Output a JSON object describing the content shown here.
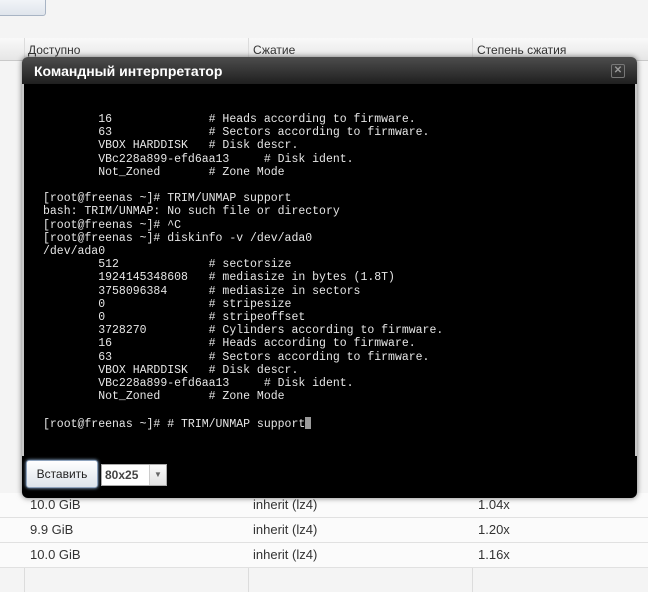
{
  "background": {
    "columns": [
      "Доступно",
      "Сжатие",
      "Степень сжатия"
    ],
    "rows": [
      {
        "available": "10.0 GiB",
        "compression": "inherit (lz4)",
        "ratio": "1.04x"
      },
      {
        "available": "9.9 GiB",
        "compression": "inherit (lz4)",
        "ratio": "1.20x"
      },
      {
        "available": "10.0 GiB",
        "compression": "inherit (lz4)",
        "ratio": "1.16x"
      }
    ]
  },
  "dialog": {
    "title": "Командный интерпретатор",
    "close_icon": "close-icon",
    "terminal_lines": [
      "        16              # Heads according to firmware.",
      "        63              # Sectors according to firmware.",
      "        VBOX HARDDISK   # Disk descr.",
      "        VBc228a899-efd6aa13     # Disk ident.",
      "        Not_Zoned       # Zone Mode",
      "",
      "[root@freenas ~]# TRIM/UNMAP support",
      "bash: TRIM/UNMAP: No such file or directory",
      "[root@freenas ~]# ^C",
      "[root@freenas ~]# diskinfo -v /dev/ada0",
      "/dev/ada0",
      "        512             # sectorsize",
      "        1924145348608   # mediasize in bytes (1.8T)",
      "        3758096384      # mediasize in sectors",
      "        0               # stripesize",
      "        0               # stripeoffset",
      "        3728270         # Cylinders according to firmware.",
      "        16              # Heads according to firmware.",
      "        63              # Sectors according to firmware.",
      "        VBOX HARDDISK   # Disk descr.",
      "        VBc228a899-efd6aa13     # Disk ident.",
      "        Not_Zoned       # Zone Mode",
      ""
    ],
    "current_input": "[root@freenas ~]# # TRIM/UNMAP support",
    "paste_label": "Вставить",
    "size_value": "80x25"
  }
}
